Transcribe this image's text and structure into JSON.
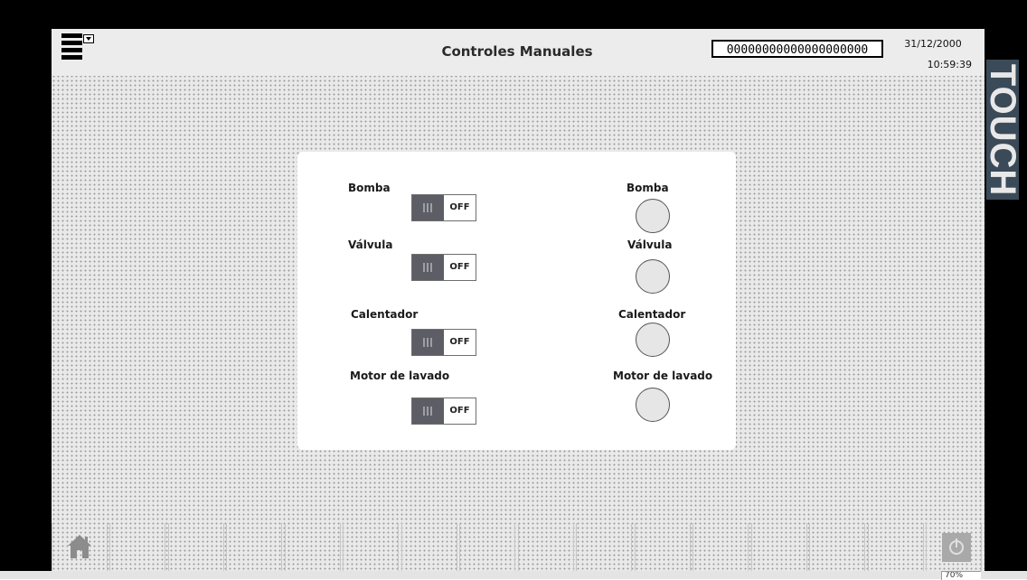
{
  "header": {
    "title": "Controles Manuales",
    "code_display": "00000000000000000000",
    "date": "31/12/2000",
    "time": "10:59:39",
    "brand": "TOUCH"
  },
  "controls": {
    "switches": [
      {
        "label": "Bomba",
        "state": "OFF"
      },
      {
        "label": "Válvula",
        "state": "OFF"
      },
      {
        "label": "Calentador",
        "state": "OFF"
      },
      {
        "label": "Motor de lavado",
        "state": "OFF"
      }
    ],
    "indicators": [
      {
        "label": "Bomba"
      },
      {
        "label": "Válvula"
      },
      {
        "label": "Calentador"
      },
      {
        "label": "Motor de lavado"
      }
    ]
  },
  "footer": {
    "home_icon": "home-icon",
    "power_icon": "power-icon"
  },
  "status": {
    "zoom": "70%"
  },
  "colors": {
    "switch_knob": "#5d5d66",
    "brand_bg": "#3a4a58",
    "panel_bg": "#ffffff",
    "screen_bg": "#e9e9e9"
  }
}
